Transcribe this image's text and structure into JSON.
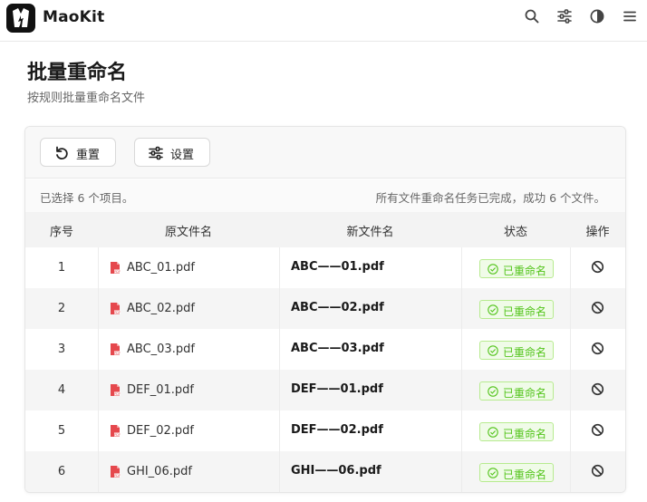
{
  "app": {
    "title": "MaoKit"
  },
  "header": {
    "icons": [
      "search-icon",
      "sliders-icon",
      "contrast-icon",
      "menu-icon"
    ]
  },
  "page": {
    "title": "批量重命名",
    "subtitle": "按规则批量重命名文件"
  },
  "toolbar": {
    "reset_label": "重置",
    "settings_label": "设置"
  },
  "status": {
    "selected": "已选择 6 个项目。",
    "message": "所有文件重命名任务已完成，成功 6 个文件。"
  },
  "table": {
    "columns": [
      "序号",
      "原文件名",
      "新文件名",
      "状态",
      "操作"
    ],
    "rows": [
      {
        "index": "1",
        "original": "ABC_01.pdf",
        "renamed": "ABC——01.pdf",
        "status": "已重命名"
      },
      {
        "index": "2",
        "original": "ABC_02.pdf",
        "renamed": "ABC——02.pdf",
        "status": "已重命名"
      },
      {
        "index": "3",
        "original": "ABC_03.pdf",
        "renamed": "ABC——03.pdf",
        "status": "已重命名"
      },
      {
        "index": "4",
        "original": "DEF_01.pdf",
        "renamed": "DEF——01.pdf",
        "status": "已重命名"
      },
      {
        "index": "5",
        "original": "DEF_02.pdf",
        "renamed": "DEF——02.pdf",
        "status": "已重命名"
      },
      {
        "index": "6",
        "original": "GHI_06.pdf",
        "renamed": "GHI——06.pdf",
        "status": "已重命名"
      }
    ]
  },
  "colors": {
    "success": "#52c41a",
    "pdf": "#e5484d"
  }
}
